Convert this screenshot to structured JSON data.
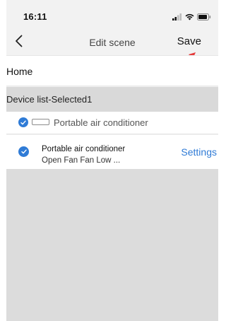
{
  "status_bar": {
    "time": "16:11",
    "icons": [
      "signal-icon",
      "wifi-icon",
      "battery-icon"
    ]
  },
  "nav": {
    "back_icon": "chevron-left-icon",
    "title": "Edit scene",
    "save_label": "Save"
  },
  "home": {
    "label": "Home"
  },
  "device_list": {
    "header": "Device list-Selected1",
    "group": {
      "label": "Portable air conditioner",
      "checked": true
    },
    "devices": [
      {
        "name": "Portable air conditioner",
        "status": "Open Fan Fan Low ...",
        "action_label": "Settings",
        "checked": true
      }
    ]
  },
  "colors": {
    "accent": "#2f7bd6",
    "annotation": "#e53b3b",
    "background": "#f2f2f2",
    "empty_area": "#dcdcdc",
    "header_band": "#d9d9d9"
  }
}
